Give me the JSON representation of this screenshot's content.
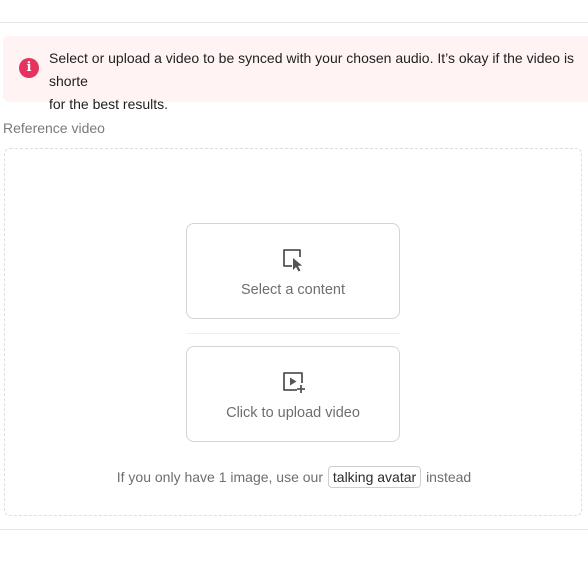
{
  "alert": {
    "icon": "info-icon",
    "line1": "Select or upload a video to be synced with your chosen audio. It’s okay if the video is shorte",
    "line2": "for the best results."
  },
  "reference": {
    "label": "Reference video",
    "select_card": {
      "icon": "cursor-select-icon",
      "label": "Select a content"
    },
    "upload_card": {
      "icon": "video-upload-icon",
      "label": "Click to upload video"
    },
    "hint": {
      "prefix": "If you only have 1 image, use our",
      "link": "talking avatar",
      "suffix": "instead"
    }
  },
  "colors": {
    "alert_bg": "#fff4f3",
    "alert_icon": "#e5325f",
    "border": "#d4d4d4"
  }
}
